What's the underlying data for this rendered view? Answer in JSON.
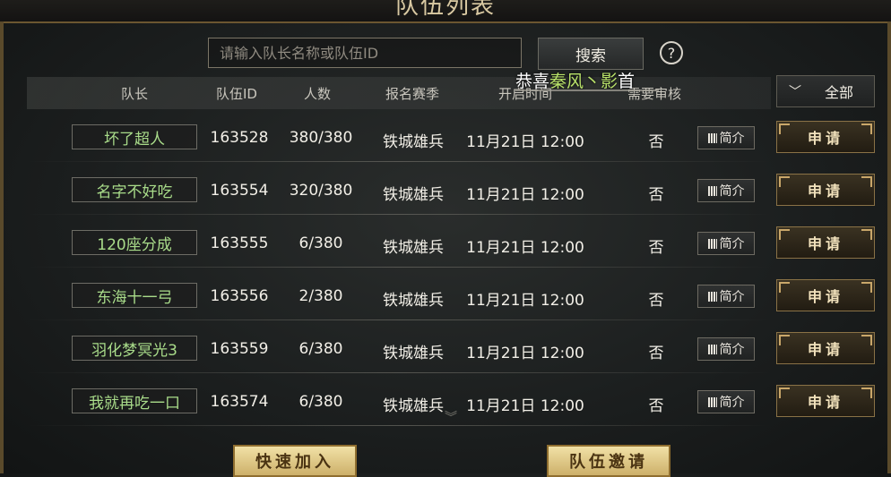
{
  "window": {
    "title": "队伍列表"
  },
  "search": {
    "placeholder": "请输入队长名称或队伍ID",
    "button_label": "搜索",
    "help_label": "?"
  },
  "banner": {
    "prefix": "恭喜",
    "highlight": "秦风丶影",
    "suffix": "首"
  },
  "filter": {
    "label": "全部",
    "icon": "chevron-down-icon"
  },
  "table": {
    "headers": [
      "队长",
      "队伍ID",
      "人数",
      "报名赛季",
      "开启时间",
      "需要审核"
    ],
    "intro_label": "简介",
    "apply_label": "申请",
    "rows": [
      {
        "leader": "坏了超人",
        "team_id": "163528",
        "members": "380/380",
        "season": "铁城雄兵",
        "start_time": "11月21日 12:00",
        "review": "否"
      },
      {
        "leader": "名字不好吃",
        "team_id": "163554",
        "members": "320/380",
        "season": "铁城雄兵",
        "start_time": "11月21日 12:00",
        "review": "否"
      },
      {
        "leader": "120座分成",
        "team_id": "163555",
        "members": "6/380",
        "season": "铁城雄兵",
        "start_time": "11月21日 12:00",
        "review": "否"
      },
      {
        "leader": "东海十一弓",
        "team_id": "163556",
        "members": "2/380",
        "season": "铁城雄兵",
        "start_time": "11月21日 12:00",
        "review": "否"
      },
      {
        "leader": "羽化梦冥光3",
        "team_id": "163559",
        "members": "6/380",
        "season": "铁城雄兵",
        "start_time": "11月21日 12:00",
        "review": "否"
      },
      {
        "leader": "我就再吃一口",
        "team_id": "163574",
        "members": "6/380",
        "season": "铁城雄兵",
        "start_time": "11月21日 12:00",
        "review": "否"
      }
    ]
  },
  "footer": {
    "quick_join": "快速加入",
    "invite": "队伍邀请"
  },
  "colors": {
    "leader_text": "#a9dc8a",
    "banner_highlight": "#b9e26a",
    "gold": "#cdb06a"
  }
}
